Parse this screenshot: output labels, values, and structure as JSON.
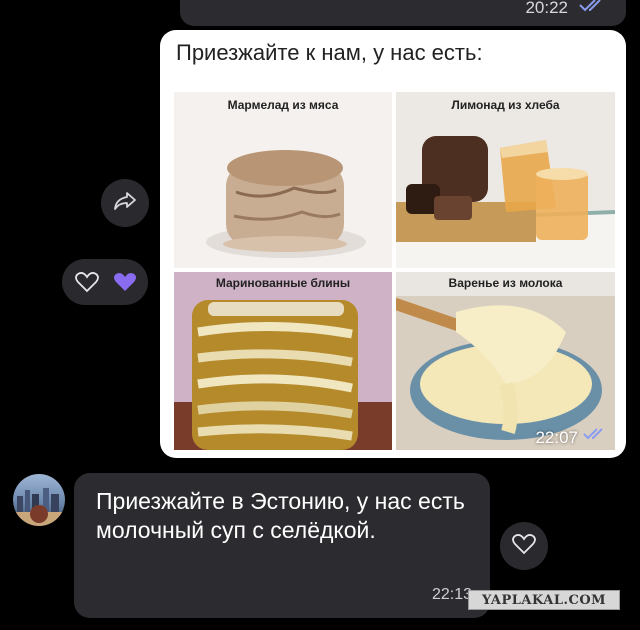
{
  "chat": {
    "top_message": {
      "time": "20:22"
    },
    "image_post": {
      "title": "Приезжайте к нам, у нас есть:",
      "time": "22:07",
      "cells": [
        {
          "label": "Мармелад из мяса"
        },
        {
          "label": "Лимонад из хлеба"
        },
        {
          "label": "Маринованные блины"
        },
        {
          "label": "Варенье из молока"
        }
      ]
    },
    "reply": {
      "text": "Приезжайте в Эстонию, у нас есть молочный суп с селёдкой.",
      "time": "22:13"
    }
  },
  "icons": {
    "forward": "share-arrow-icon",
    "reaction_outline": "heart-outline-icon",
    "reaction_filled": "heart-filled-icon",
    "read_receipt": "double-check-icon"
  },
  "colors": {
    "background": "#000000",
    "bubble": "#2c2c30",
    "accent_heart": "#8a6cf0",
    "read_check": "#8a9cf0"
  },
  "watermark": "YAPLAKAL.COM"
}
